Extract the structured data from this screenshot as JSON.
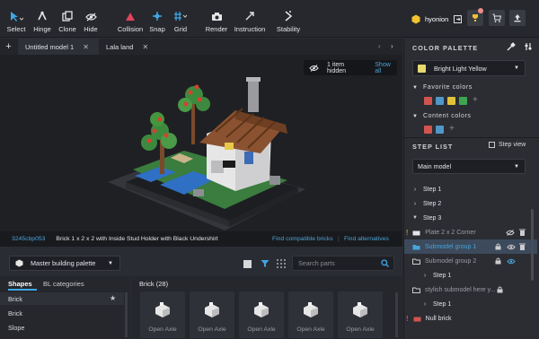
{
  "toolbar": {
    "tools": [
      {
        "label": "Select",
        "icon": "select-cursor-icon"
      },
      {
        "label": "Hinge",
        "icon": "hinge-icon"
      },
      {
        "label": "Clone",
        "icon": "clone-icon"
      },
      {
        "label": "Hide",
        "icon": "hide-eye-icon"
      },
      {
        "label": "Collision",
        "icon": "collision-triangle-icon"
      },
      {
        "label": "Snap",
        "icon": "snap-icon"
      },
      {
        "label": "Grid",
        "icon": "grid-icon"
      },
      {
        "label": "Render",
        "icon": "camera-icon"
      },
      {
        "label": "Instruction",
        "icon": "instruction-icon"
      },
      {
        "label": "Stability",
        "icon": "stability-icon"
      }
    ],
    "username": "hyonion"
  },
  "tabs": [
    {
      "label": "Untitled model 1"
    },
    {
      "label": "Lala land"
    }
  ],
  "viewport": {
    "hidden_count": "1 item hidden",
    "show_all": "Show all"
  },
  "part_info": {
    "part_id": "3245cbp053",
    "part_name": "Brick 1 x 2 x 2 with Inside Stud Holder with Black Undershirt",
    "find_compatible": "Find compatible bricks",
    "find_alternatives": "Find alternatives"
  },
  "palette_bar": {
    "palette_name": "Master building palette",
    "search_placeholder": "Search parts"
  },
  "shapes_panel": {
    "tab_shapes": "Shapes",
    "tab_bl": "BL categories",
    "items": [
      "Brick",
      "Brick",
      "Slope"
    ]
  },
  "bricks_panel": {
    "title": "Brick (28)",
    "cards": [
      "Open Axle",
      "Open Axle",
      "Open Axle",
      "Open Axle",
      "Open Axle"
    ]
  },
  "color_palette": {
    "title": "COLOR PALETTE",
    "selected_color": "Bright Light Yellow",
    "selected_hex": "#e8d86e",
    "favorites_title": "Favorite colors",
    "favorites": [
      "#d2544e",
      "#4f97c9",
      "#e2c13a",
      "#3ea64f"
    ],
    "content_title": "Content colors",
    "content": [
      "#d2544e",
      "#4f97c9"
    ]
  },
  "step_list": {
    "title": "STEP LIST",
    "step_view": "Step view",
    "model_select": "Main model",
    "items": [
      {
        "label": "Step 1"
      },
      {
        "label": "Step 2"
      },
      {
        "label": "Step 3"
      },
      {
        "label": "Plate 2 x 2 Corner"
      },
      {
        "label": "Submodel group 1"
      },
      {
        "label": "Submodel group 2"
      },
      {
        "label": "Step 1"
      },
      {
        "label": "stylish submodel here y..."
      },
      {
        "label": "Step 1"
      },
      {
        "label": "Null brick"
      }
    ]
  }
}
